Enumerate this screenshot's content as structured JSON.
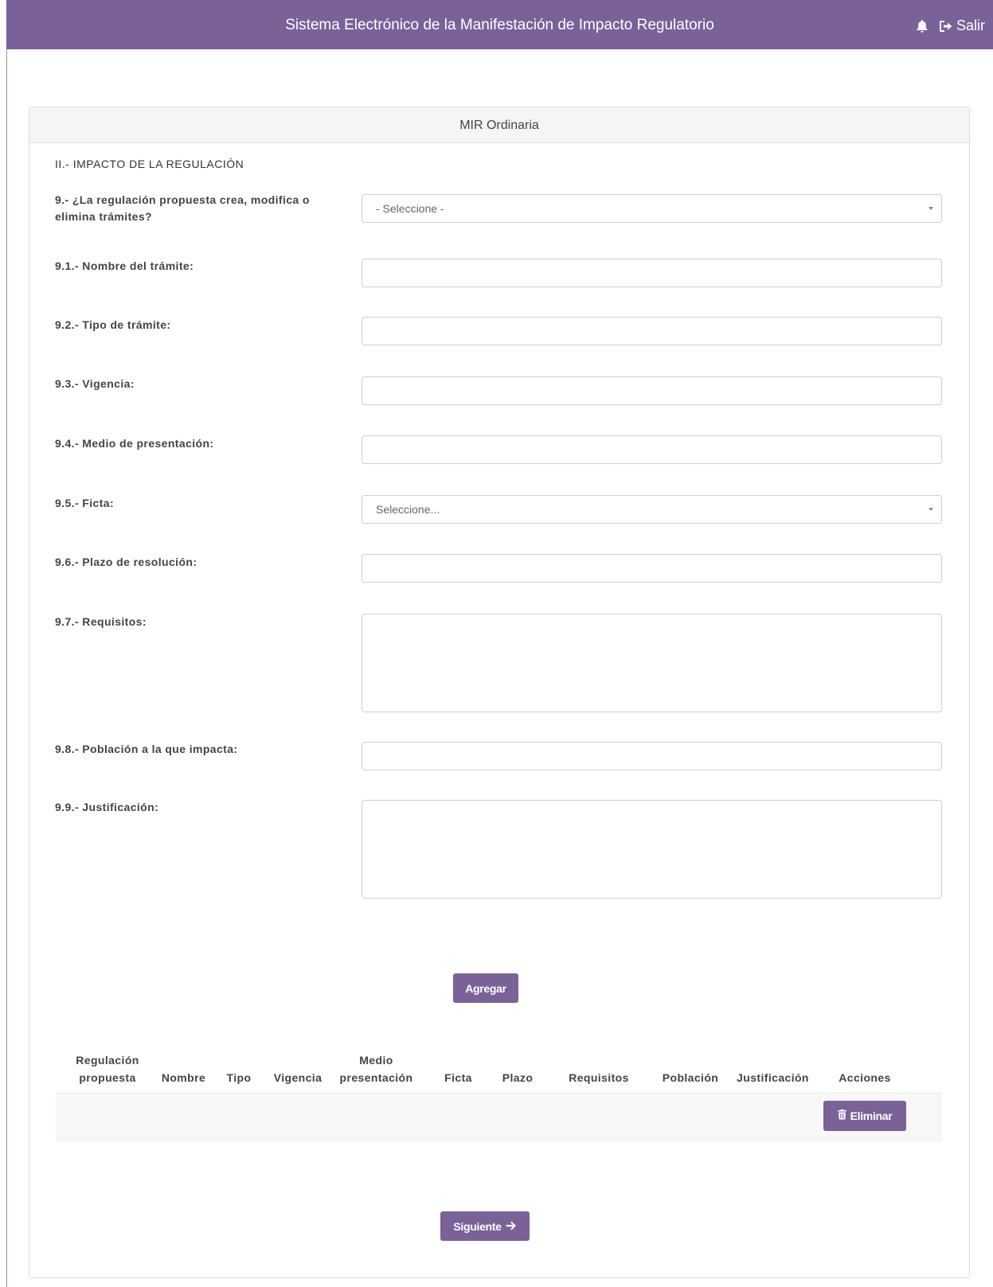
{
  "header": {
    "title": "Sistema Electrónico de la Manifestación de Impacto Regulatorio",
    "logout_label": "Salir",
    "icons": {
      "notifications": "bell-icon",
      "logout": "sign-out-icon"
    },
    "color": "#7a6299"
  },
  "panel": {
    "title": "MIR Ordinaria",
    "section_title": "II.- IMPACTO DE LA REGULACIÓN"
  },
  "form": {
    "q9": {
      "label": "9.- ¿La regulación propuesta crea, modifica o elimina trámites?",
      "selected": "- Seleccione -"
    },
    "q9_1": {
      "label": "9.1.- Nombre del trámite:",
      "value": ""
    },
    "q9_2": {
      "label": "9.2.- Tipo de trámite:",
      "value": ""
    },
    "q9_3": {
      "label": "9.3.- Vigencia:",
      "value": ""
    },
    "q9_4": {
      "label": "9.4.- Medio de presentación:",
      "value": ""
    },
    "q9_5": {
      "label": "9.5.- Ficta:",
      "selected": "Seleccione..."
    },
    "q9_6": {
      "label": "9.6.- Plazo de resolución:",
      "value": ""
    },
    "q9_7": {
      "label": "9.7.- Requisitos:",
      "value": ""
    },
    "q9_8": {
      "label": "9.8.- Población a la que impacta:",
      "value": ""
    },
    "q9_9": {
      "label": "9.9.- Justificación:",
      "value": ""
    },
    "add_label": "Agregar"
  },
  "table": {
    "columns": {
      "regulacion": "Regulación propuesta",
      "nombre": "Nombre",
      "tipo": "Tipo",
      "vigencia": "Vigencia",
      "medio": "Medio presentación",
      "ficta": "Ficta",
      "plazo": "Plazo",
      "requisitos": "Requisitos",
      "poblacion": "Población",
      "justificacion": "Justificación",
      "acciones": "Acciones"
    },
    "rows": [
      {
        "delete_label": "Eliminar"
      }
    ]
  },
  "footer": {
    "next_label": "Siguiente"
  }
}
